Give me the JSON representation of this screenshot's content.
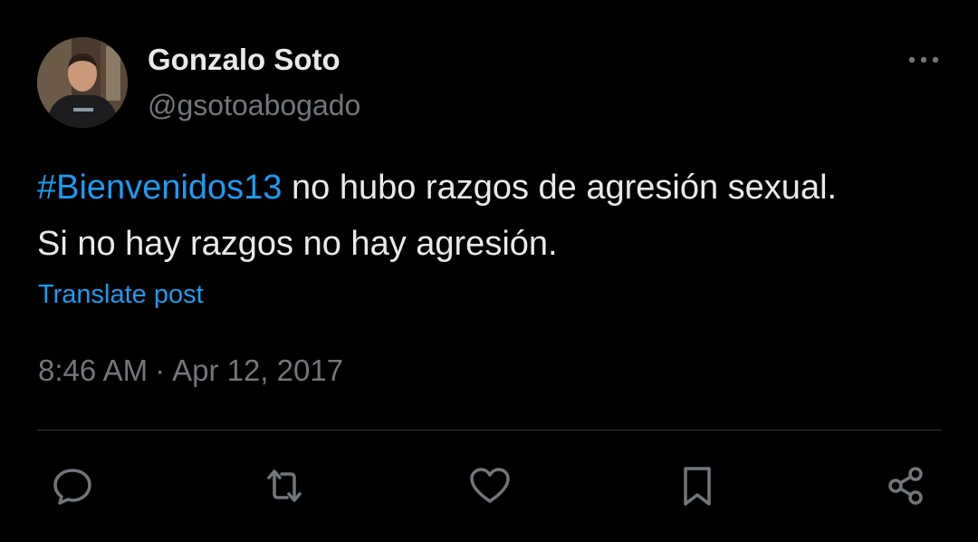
{
  "author": {
    "display_name": "Gonzalo Soto",
    "handle": "@gsotoabogado",
    "avatar_icon": "profile-photo"
  },
  "post": {
    "hashtag": "#Bienvenidos13",
    "text_line1_rest": " no hubo razgos de agresión sexual.",
    "text_line2": "Si no hay razgos no hay agresión.",
    "translate_label": "Translate post",
    "time": "8:46 AM",
    "separator": "·",
    "date": "Apr 12, 2017"
  },
  "actions": [
    {
      "name": "reply",
      "icon": "speech-bubble-icon"
    },
    {
      "name": "repost",
      "icon": "repost-arrows-icon"
    },
    {
      "name": "like",
      "icon": "heart-icon"
    },
    {
      "name": "bookmark",
      "icon": "bookmark-icon"
    },
    {
      "name": "share",
      "icon": "share-nodes-icon"
    }
  ],
  "colors": {
    "background": "#000000",
    "text_primary": "#e7e9ea",
    "text_secondary": "#71767b",
    "accent": "#1d9bf0",
    "divider": "#2f3336"
  }
}
